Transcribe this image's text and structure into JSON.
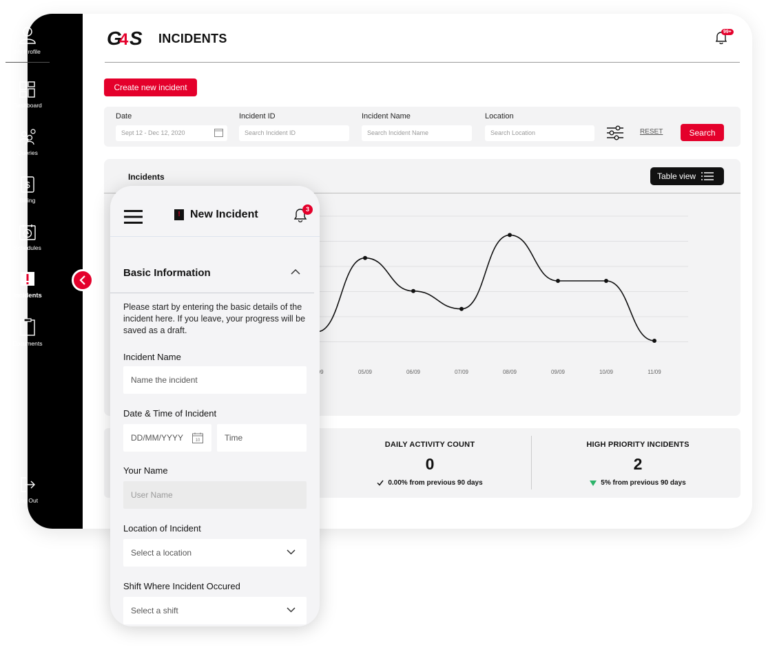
{
  "sidebar": {
    "items": [
      {
        "label": "My Profile",
        "icon": "user-icon"
      },
      {
        "label": "Dashboard",
        "icon": "dashboard-icon"
      },
      {
        "label": "Queries",
        "icon": "queries-icon"
      },
      {
        "label": "Billing",
        "icon": "billing-icon"
      },
      {
        "label": "Schedules",
        "icon": "schedules-icon"
      },
      {
        "label": "Incidents",
        "icon": "incident-alert-icon",
        "active": true
      },
      {
        "label": "Documents",
        "icon": "documents-icon"
      },
      {
        "label": "Log Out",
        "icon": "logout-icon"
      }
    ]
  },
  "header": {
    "logo_text": "G4S",
    "title": "INCIDENTS",
    "notification_badge": "99+"
  },
  "actions": {
    "create_label": "Create new incident"
  },
  "filters": {
    "date_label": "Date",
    "date_value": "Sept 12 - Dec 12, 2020",
    "incident_id_label": "Incident ID",
    "incident_id_placeholder": "Search Incident ID",
    "incident_name_label": "Incident Name",
    "incident_name_placeholder": "Search Incident Name",
    "location_label": "Location",
    "location_placeholder": "Search Location",
    "reset_label": "RESET",
    "search_label": "Search"
  },
  "chart_panel": {
    "title": "Incidents",
    "table_view_label": "Table view"
  },
  "chart_data": {
    "type": "line",
    "x": [
      "05/09",
      "06/09",
      "07/09",
      "08/09",
      "09/09",
      "10/09",
      "11/09"
    ],
    "visible_tick_fragment": "/09",
    "y": [
      0.78,
      0.52,
      0.38,
      0.96,
      0.6,
      0.6,
      0.13
    ],
    "y_partial_left": 0.2,
    "grid": true,
    "xlabel": "",
    "ylabel": ""
  },
  "stats": [
    {
      "title": "DAILY ACTIVITY COUNT",
      "value": "0",
      "delta": "0.00% from previous 90 days",
      "trend": "flat"
    },
    {
      "title": "HIGH PRIORITY INCIDENTS",
      "value": "2",
      "delta": "5% from previous 90 days",
      "trend": "down"
    }
  ],
  "colors": {
    "brand_red": "#e4002b",
    "trend_green": "#2db46a"
  },
  "mobile": {
    "title": "New Incident",
    "notification_badge": "3",
    "section_title": "Basic Information",
    "intro": "Please start by entering the basic details of the incident here. If you leave, your progress will be saved as a draft.",
    "incident_name_label": "Incident Name",
    "incident_name_placeholder": "Name the incident",
    "datetime_label": "Date & Time of Incident",
    "date_placeholder": "DD/MM/YYYY",
    "calendar_day": "10",
    "time_placeholder": "Time",
    "your_name_label": "Your Name",
    "your_name_placeholder": "User Name",
    "location_label": "Location of Incident",
    "location_placeholder": "Select a location",
    "shift_label": "Shift Where Incident Occured",
    "shift_placeholder": "Select a shift"
  }
}
